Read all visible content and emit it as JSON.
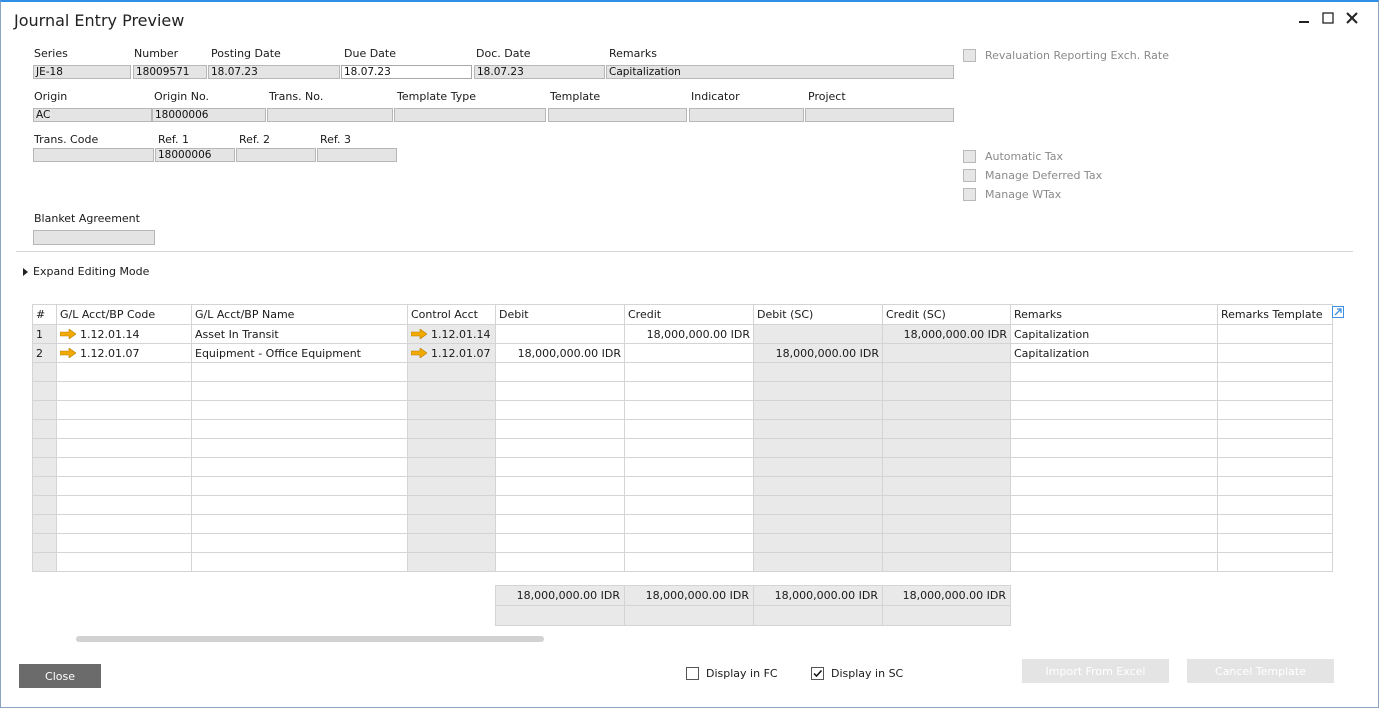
{
  "window": {
    "title": "Journal Entry Preview"
  },
  "header": {
    "row1": {
      "series": {
        "label": "Series",
        "value": "JE-18"
      },
      "number": {
        "label": "Number",
        "value": "18009571"
      },
      "posting_date": {
        "label": "Posting Date",
        "value": "18.07.23"
      },
      "due_date": {
        "label": "Due Date",
        "value": "18.07.23"
      },
      "doc_date": {
        "label": "Doc. Date",
        "value": "18.07.23"
      },
      "remarks": {
        "label": "Remarks",
        "value": "Capitalization"
      }
    },
    "row2": {
      "origin": {
        "label": "Origin",
        "value": "AC"
      },
      "origin_no": {
        "label": "Origin No.",
        "value": "18000006"
      },
      "trans_no": {
        "label": "Trans. No.",
        "value": ""
      },
      "template_type": {
        "label": "Template Type",
        "value": ""
      },
      "template": {
        "label": "Template",
        "value": ""
      },
      "indicator": {
        "label": "Indicator",
        "value": ""
      },
      "project": {
        "label": "Project",
        "value": ""
      }
    },
    "row3": {
      "trans_code": {
        "label": "Trans. Code",
        "value": ""
      },
      "ref1": {
        "label": "Ref. 1",
        "value": "18000006"
      },
      "ref2": {
        "label": "Ref. 2",
        "value": ""
      },
      "ref3": {
        "label": "Ref. 3",
        "value": ""
      }
    },
    "blanket_agreement": {
      "label": "Blanket Agreement",
      "value": ""
    }
  },
  "options": {
    "revaluation": "Revaluation Reporting Exch. Rate",
    "automatic_tax": "Automatic Tax",
    "manage_deferred_tax": "Manage Deferred Tax",
    "manage_wtax": "Manage WTax"
  },
  "expand_editing_mode": "Expand Editing Mode",
  "grid": {
    "columns": [
      "#",
      "G/L Acct/BP Code",
      "G/L Acct/BP Name",
      "Control Acct",
      "Debit",
      "Credit",
      "Debit (SC)",
      "Credit (SC)",
      "Remarks",
      "Remarks Template"
    ],
    "rows": [
      {
        "num": "1",
        "code": "1.12.01.14",
        "name": "Asset In Transit",
        "control": "1.12.01.14",
        "debit": "",
        "credit": "18,000,000.00 IDR",
        "debit_sc": "",
        "credit_sc": "18,000,000.00 IDR",
        "remarks": "Capitalization",
        "remarks_template": ""
      },
      {
        "num": "2",
        "code": "1.12.01.07",
        "name": "Equipment - Office Equipment",
        "control": "1.12.01.07",
        "debit": "18,000,000.00 IDR",
        "credit": "",
        "debit_sc": "18,000,000.00 IDR",
        "credit_sc": "",
        "remarks": "Capitalization",
        "remarks_template": ""
      }
    ],
    "totals": {
      "debit": "18,000,000.00 IDR",
      "credit": "18,000,000.00 IDR",
      "debit_sc": "18,000,000.00 IDR",
      "credit_sc": "18,000,000.00 IDR"
    }
  },
  "footer": {
    "close": "Close",
    "display_fc": {
      "label": "Display in FC",
      "checked": false
    },
    "display_sc": {
      "label": "Display in SC",
      "checked": true
    },
    "import_excel": "Import From Excel",
    "cancel_template": "Cancel Template"
  },
  "colors": {
    "title_border": "#2f8ee5",
    "link_arrow": "#f2a900",
    "close_button": "#6b6b6b"
  }
}
